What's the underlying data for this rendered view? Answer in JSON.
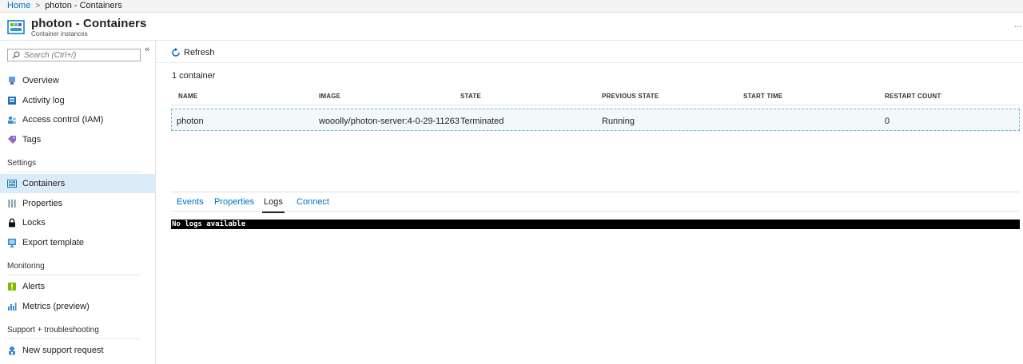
{
  "breadcrumb": {
    "home": "Home",
    "separator": ">",
    "current": "photon - Containers"
  },
  "blade": {
    "title": "photon - Containers",
    "subtitle": "Container instances",
    "icon": "container-instances-icon",
    "more": "..."
  },
  "sidebar": {
    "search_placeholder": "Search (Ctrl+/)",
    "collapse": "«",
    "items_top": [
      {
        "label": "Overview",
        "icon": "overview-icon"
      },
      {
        "label": "Activity log",
        "icon": "activity-log-icon"
      },
      {
        "label": "Access control (IAM)",
        "icon": "iam-icon"
      },
      {
        "label": "Tags",
        "icon": "tag-icon"
      }
    ],
    "sections": {
      "settings": "Settings",
      "monitoring": "Monitoring",
      "support": "Support + troubleshooting"
    },
    "settings_items": [
      {
        "label": "Containers",
        "icon": "containers-icon",
        "active": true
      },
      {
        "label": "Properties",
        "icon": "properties-icon"
      },
      {
        "label": "Locks",
        "icon": "lock-icon"
      },
      {
        "label": "Export template",
        "icon": "export-template-icon"
      }
    ],
    "monitoring_items": [
      {
        "label": "Alerts",
        "icon": "alert-icon"
      },
      {
        "label": "Metrics (preview)",
        "icon": "metrics-icon"
      }
    ],
    "support_items": [
      {
        "label": "New support request",
        "icon": "support-icon"
      }
    ]
  },
  "toolbar": {
    "refresh_label": "Refresh",
    "refresh_icon": "refresh-icon",
    "accent": "#0072c6"
  },
  "containers": {
    "count_label": "1 container",
    "columns": [
      "NAME",
      "IMAGE",
      "STATE",
      "PREVIOUS STATE",
      "START TIME",
      "RESTART COUNT"
    ],
    "rows": [
      {
        "name": "photon",
        "image": "wooolly/photon-server:4-0-29-11263",
        "state": "Terminated",
        "previous_state": "Running",
        "start_time": "",
        "restart_count": "0"
      }
    ]
  },
  "detail_tabs": {
    "tabs": [
      "Events",
      "Properties",
      "Logs",
      "Connect"
    ],
    "active": "Logs"
  },
  "logs": {
    "text": "No logs available"
  }
}
